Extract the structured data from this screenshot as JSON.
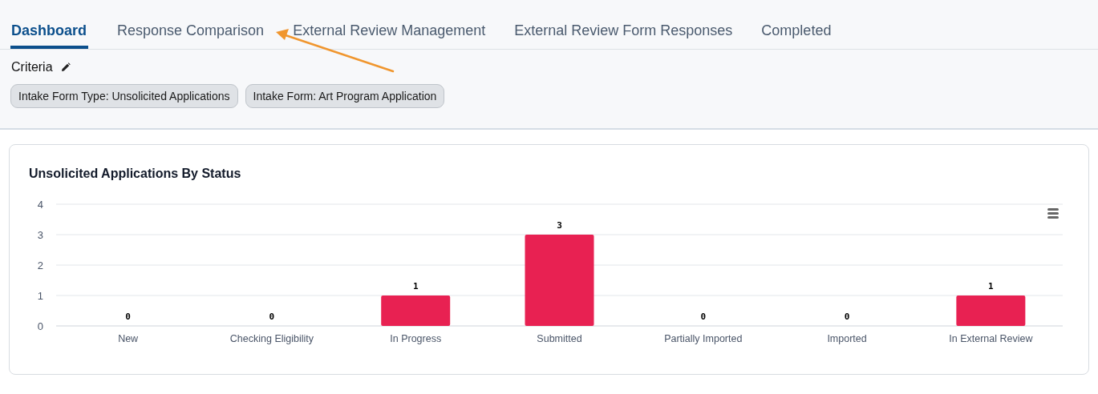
{
  "tabs": [
    {
      "label": "Dashboard",
      "selected": true
    },
    {
      "label": "Response Comparison",
      "selected": false
    },
    {
      "label": "External Review Management",
      "selected": false
    },
    {
      "label": "External Review Form Responses",
      "selected": false
    },
    {
      "label": "Completed",
      "selected": false
    }
  ],
  "criteria": {
    "label": "Criteria",
    "filters": [
      "Intake Form Type: Unsolicited Applications",
      "Intake Form: Art Program Application"
    ]
  },
  "chart": {
    "chart_data": {
      "type": "bar",
      "title": "Unsolicited Applications By Status",
      "categories": [
        "New",
        "Checking Eligibility",
        "In Progress",
        "Submitted",
        "Partially Imported",
        "Imported",
        "In External Review"
      ],
      "series": [
        {
          "color": "#e82152",
          "values": [
            0,
            0,
            1,
            3,
            0,
            0,
            1
          ]
        }
      ],
      "ylim": [
        0,
        4
      ],
      "yticks": [
        0,
        1,
        2,
        3,
        4
      ],
      "grid": true,
      "data_labels": true
    }
  },
  "annotations": [
    {
      "kind": "arrow",
      "color": "#f0962e"
    }
  ]
}
